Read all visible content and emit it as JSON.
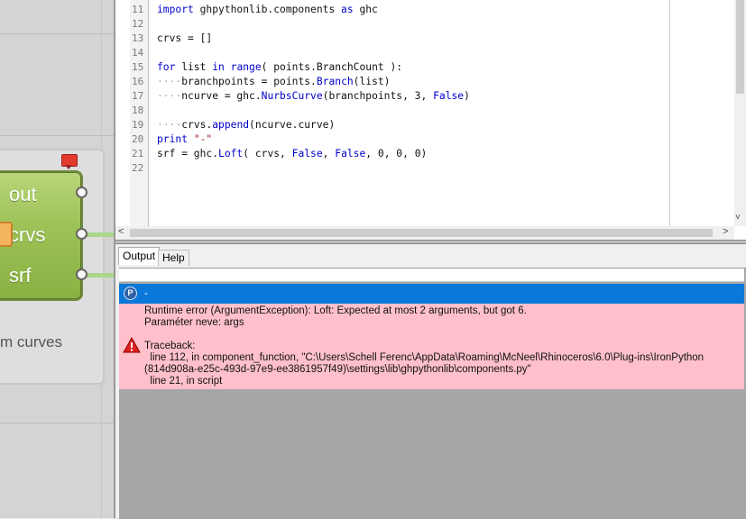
{
  "canvas": {
    "outputs": [
      "out",
      "crvs",
      "srf"
    ],
    "group_label": "m curves"
  },
  "editor": {
    "lines": [
      {
        "num": "11",
        "segments": [
          {
            "t": "import",
            "k": "kw"
          },
          {
            "t": " ghpythonlib.components ",
            "k": ""
          },
          {
            "t": "as",
            "k": "kw"
          },
          {
            "t": " ghc",
            "k": ""
          }
        ]
      },
      {
        "num": "12",
        "segments": []
      },
      {
        "num": "13",
        "segments": [
          {
            "t": "crvs = []",
            "k": ""
          }
        ]
      },
      {
        "num": "14",
        "segments": []
      },
      {
        "num": "15",
        "segments": [
          {
            "t": "for",
            "k": "kw"
          },
          {
            "t": " list ",
            "k": ""
          },
          {
            "t": "in",
            "k": "kw"
          },
          {
            "t": " ",
            "k": ""
          },
          {
            "t": "range",
            "k": "kw"
          },
          {
            "t": "( points.BranchCount ):",
            "k": ""
          }
        ]
      },
      {
        "num": "16",
        "segments": [
          {
            "t": "····",
            "k": "dots"
          },
          {
            "t": "branchpoints = points.",
            "k": ""
          },
          {
            "t": "Branch",
            "k": "kw"
          },
          {
            "t": "(list)",
            "k": ""
          }
        ]
      },
      {
        "num": "17",
        "segments": [
          {
            "t": "····",
            "k": "dots"
          },
          {
            "t": "ncurve = ghc.",
            "k": ""
          },
          {
            "t": "NurbsCurve",
            "k": "kw"
          },
          {
            "t": "(branchpoints, 3, ",
            "k": ""
          },
          {
            "t": "False",
            "k": "kw"
          },
          {
            "t": ")",
            "k": ""
          }
        ]
      },
      {
        "num": "18",
        "segments": []
      },
      {
        "num": "19",
        "segments": [
          {
            "t": "····",
            "k": "dots"
          },
          {
            "t": "crvs.",
            "k": ""
          },
          {
            "t": "append",
            "k": "kw"
          },
          {
            "t": "(ncurve.curve)",
            "k": ""
          }
        ]
      },
      {
        "num": "20",
        "segments": [
          {
            "t": "print",
            "k": "kw"
          },
          {
            "t": " ",
            "k": ""
          },
          {
            "t": "\"-\"",
            "k": "str"
          }
        ]
      },
      {
        "num": "21",
        "segments": [
          {
            "t": "srf = ghc.",
            "k": ""
          },
          {
            "t": "Loft",
            "k": "kw"
          },
          {
            "t": "( crvs, ",
            "k": ""
          },
          {
            "t": "False",
            "k": "kw"
          },
          {
            "t": ", ",
            "k": ""
          },
          {
            "t": "False",
            "k": "kw"
          },
          {
            "t": ", 0, 0, 0)",
            "k": ""
          }
        ]
      },
      {
        "num": "22",
        "segments": []
      }
    ]
  },
  "output": {
    "tabs": {
      "output": "Output",
      "help": "Help"
    },
    "info_text": "-",
    "error": {
      "line1": "Runtime error (ArgumentException): Loft: Expected at most 2 arguments, but got 6.",
      "line2": "Paraméter neve: args",
      "traceback_title": "Traceback:",
      "trace1": "  line 112, in component_function, \"C:\\Users\\Schell Ferenc\\AppData\\Roaming\\McNeel\\Rhinoceros\\6.0\\Plug-ins\\IronPython",
      "trace2": "(814d908a-e25c-493d-97e9-ee3861957f49)\\settings\\lib\\ghpythonlib\\components.py\"",
      "trace3": "  line 21, in script"
    }
  },
  "colors": {
    "selected_row": "#0a78d8",
    "error_bg": "#ffc0cb",
    "component_green": "#9cc156",
    "keyword": "#0000cc"
  },
  "icons": {
    "scroll_left": "<",
    "scroll_right": ">",
    "scroll_down": "˅"
  }
}
